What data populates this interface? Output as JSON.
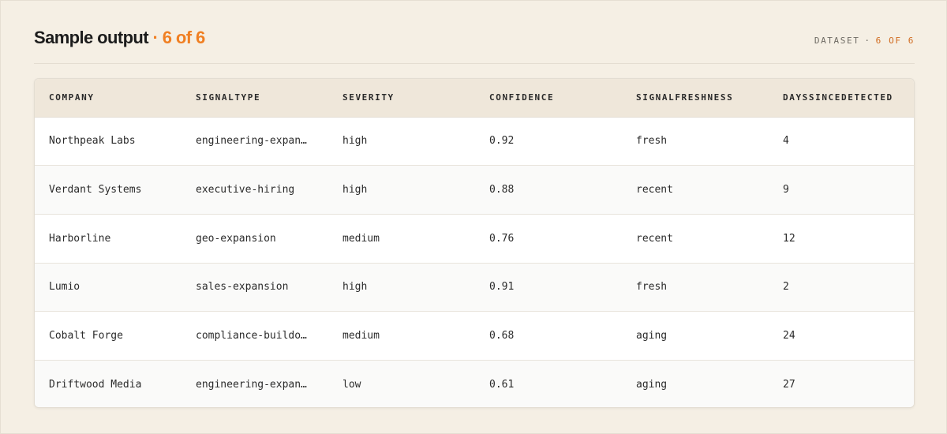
{
  "header": {
    "title": "Sample output",
    "separator": "·",
    "count": "6 of 6",
    "tag_label": "DATASET",
    "tag_separator": "·",
    "tag_count": "6 OF 6"
  },
  "colors": {
    "accent": "#f07f22",
    "background": "#f5efe4",
    "header_row": "#efe7da"
  },
  "table": {
    "columns": [
      "COMPANY",
      "SIGNALTYPE",
      "SEVERITY",
      "CONFIDENCE",
      "SIGNALFRESHNESS",
      "DAYSSINCEDETECTED"
    ],
    "rows": [
      [
        "Northpeak Labs",
        "engineering-expan…",
        "high",
        "0.92",
        "fresh",
        "4"
      ],
      [
        "Verdant Systems",
        "executive-hiring",
        "high",
        "0.88",
        "recent",
        "9"
      ],
      [
        "Harborline",
        "geo-expansion",
        "medium",
        "0.76",
        "recent",
        "12"
      ],
      [
        "Lumio",
        "sales-expansion",
        "high",
        "0.91",
        "fresh",
        "2"
      ],
      [
        "Cobalt Forge",
        "compliance-buildo…",
        "medium",
        "0.68",
        "aging",
        "24"
      ],
      [
        "Driftwood Media",
        "engineering-expan…",
        "low",
        "0.61",
        "aging",
        "27"
      ]
    ]
  }
}
